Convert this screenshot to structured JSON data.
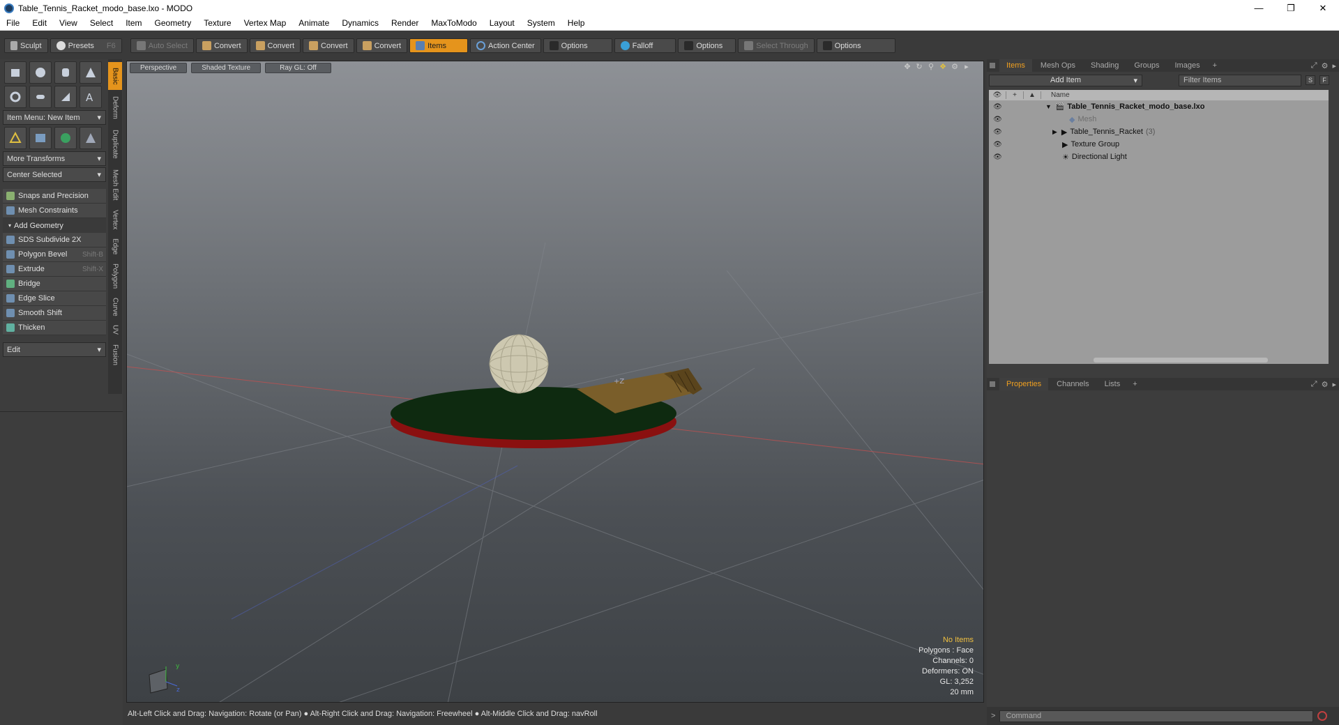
{
  "window": {
    "title": "Table_Tennis_Racket_modo_base.lxo - MODO"
  },
  "menu": [
    "File",
    "Edit",
    "View",
    "Select",
    "Item",
    "Geometry",
    "Texture",
    "Vertex Map",
    "Animate",
    "Dynamics",
    "Render",
    "MaxToModo",
    "Layout",
    "System",
    "Help"
  ],
  "toolbar": {
    "sculpt": "Sculpt",
    "presets": "Presets",
    "presets_key": "F6",
    "auto_select": "Auto Select",
    "convert": "Convert",
    "items": "Items",
    "action_center": "Action Center",
    "options": "Options",
    "falloff": "Falloff",
    "select_through": "Select Through"
  },
  "left": {
    "item_menu": "Item Menu: New Item",
    "more_transforms": "More Transforms",
    "center_selected": "Center Selected",
    "snaps": "Snaps and Precision",
    "mesh_constraints": "Mesh Constraints",
    "add_geometry": "Add Geometry",
    "tools": [
      {
        "label": "SDS Subdivide 2X",
        "key": ""
      },
      {
        "label": "Polygon Bevel",
        "key": "Shift-B"
      },
      {
        "label": "Extrude",
        "key": "Shift-X"
      },
      {
        "label": "Bridge",
        "key": ""
      },
      {
        "label": "Edge Slice",
        "key": ""
      },
      {
        "label": "Smooth Shift",
        "key": ""
      },
      {
        "label": "Thicken",
        "key": ""
      }
    ],
    "edit": "Edit"
  },
  "vtabs": [
    "Basic",
    "Deform",
    "Duplicate",
    "Mesh Edit",
    "Vertex",
    "Edge",
    "Polygon",
    "Curve",
    "UV",
    "Fusion"
  ],
  "viewport": {
    "view": "Perspective",
    "shading": "Shaded Texture",
    "raygl": "Ray GL: Off",
    "axis_label": "+Z"
  },
  "stats": {
    "sel": "No Items",
    "polygons": "Polygons : Face",
    "channels": "Channels: 0",
    "deformers": "Deformers: ON",
    "gl": "GL: 3,252",
    "unit": "20 mm"
  },
  "status": {
    "hint": "Alt-Left Click and Drag: Navigation: Rotate (or Pan) ● Alt-Right Click and Drag: Navigation: Freewheel ● Alt-Middle Click and Drag: navRoll"
  },
  "right": {
    "tabs": [
      "Items",
      "Mesh Ops",
      "Shading",
      "Groups",
      "Images"
    ],
    "add_item": "Add Item",
    "filter": "Filter Items",
    "col_name": "Name",
    "tree": [
      {
        "label": "Table_Tennis_Racket_modo_base.lxo",
        "count": ""
      },
      {
        "label": "Mesh",
        "count": ""
      },
      {
        "label": "Table_Tennis_Racket",
        "count": "(3)"
      },
      {
        "label": "Texture Group",
        "count": ""
      },
      {
        "label": "Directional Light",
        "count": ""
      }
    ],
    "ptabs": [
      "Properties",
      "Channels",
      "Lists"
    ],
    "command": "Command",
    "s_btn": "S",
    "f_btn": "F"
  },
  "colors": {
    "accent": "#e5941c",
    "racket_face": "#0e2a10",
    "racket_edge": "#8a1010"
  }
}
